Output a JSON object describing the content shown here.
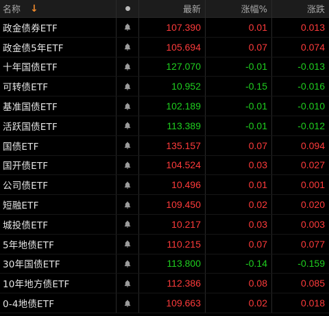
{
  "header": {
    "name": "名称",
    "price": "最新",
    "pct": "涨幅%",
    "chg": "涨跌",
    "sort_icon": "arrow-down-icon",
    "dot_icon": "dot-icon"
  },
  "colors": {
    "up": "#ff3b3b",
    "down": "#1fd01f",
    "sort": "#f08a2c"
  },
  "rows": [
    {
      "name": "政金债券ETF",
      "price": "107.390",
      "pct": "0.01",
      "chg": "0.013",
      "dir": "up"
    },
    {
      "name": "政金债5年ETF",
      "price": "105.694",
      "pct": "0.07",
      "chg": "0.074",
      "dir": "up"
    },
    {
      "name": "十年国债ETF",
      "price": "127.070",
      "pct": "-0.01",
      "chg": "-0.013",
      "dir": "down"
    },
    {
      "name": "可转债ETF",
      "price": "10.952",
      "pct": "-0.15",
      "chg": "-0.016",
      "dir": "down"
    },
    {
      "name": "基准国债ETF",
      "price": "102.189",
      "pct": "-0.01",
      "chg": "-0.010",
      "dir": "down"
    },
    {
      "name": "活跃国债ETF",
      "price": "113.389",
      "pct": "-0.01",
      "chg": "-0.012",
      "dir": "down"
    },
    {
      "name": "国债ETF",
      "price": "135.157",
      "pct": "0.07",
      "chg": "0.094",
      "dir": "up"
    },
    {
      "name": "国开债ETF",
      "price": "104.524",
      "pct": "0.03",
      "chg": "0.027",
      "dir": "up"
    },
    {
      "name": "公司债ETF",
      "price": "10.496",
      "pct": "0.01",
      "chg": "0.001",
      "dir": "up"
    },
    {
      "name": "短融ETF",
      "price": "109.450",
      "pct": "0.02",
      "chg": "0.020",
      "dir": "up"
    },
    {
      "name": "城投债ETF",
      "price": "10.217",
      "pct": "0.03",
      "chg": "0.003",
      "dir": "up"
    },
    {
      "name": "5年地债ETF",
      "price": "110.215",
      "pct": "0.07",
      "chg": "0.077",
      "dir": "up"
    },
    {
      "name": "30年国债ETF",
      "price": "113.800",
      "pct": "-0.14",
      "chg": "-0.159",
      "dir": "down"
    },
    {
      "name": "10年地方债ETF",
      "price": "112.386",
      "pct": "0.08",
      "chg": "0.085",
      "dir": "up"
    },
    {
      "name": "0-4地债ETF",
      "price": "109.663",
      "pct": "0.02",
      "chg": "0.018",
      "dir": "up"
    }
  ]
}
